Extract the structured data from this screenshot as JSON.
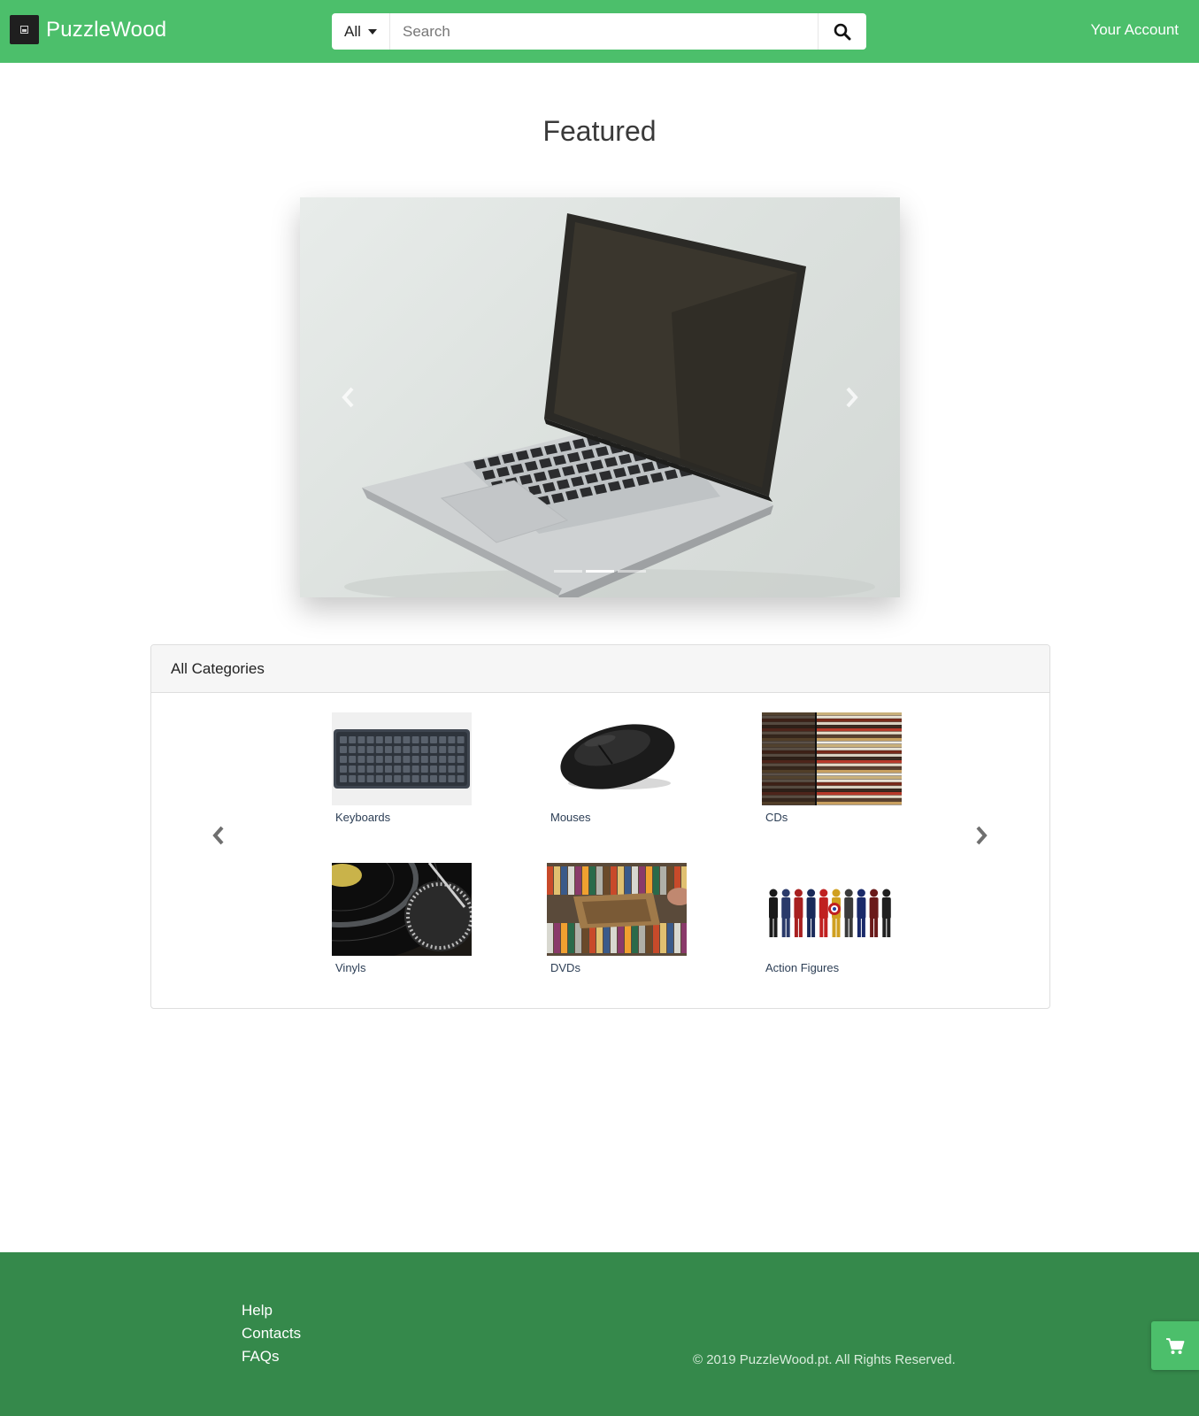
{
  "header": {
    "brand": "PuzzleWood",
    "search_scope": "All",
    "search_placeholder": "Search",
    "account_label": "Your Account"
  },
  "featured": {
    "title": "Featured",
    "slide_count": 3,
    "active_slide": 2
  },
  "categories": {
    "title": "All Categories",
    "items": [
      {
        "label": "Keyboards",
        "icon": "keyboard-thumbnail"
      },
      {
        "label": "Mouses",
        "icon": "mouse-thumbnail"
      },
      {
        "label": "CDs",
        "icon": "cds-thumbnail"
      },
      {
        "label": "Vinyls",
        "icon": "vinyl-thumbnail"
      },
      {
        "label": "DVDs",
        "icon": "dvds-thumbnail"
      },
      {
        "label": "Action Figures",
        "icon": "action-figures-thumbnail"
      }
    ]
  },
  "footer": {
    "links": [
      "Help",
      "Contacts",
      "FAQs"
    ],
    "copyright": "© 2019 PuzzleWood.pt. All Rights Reserved."
  },
  "colors": {
    "primary": "#4cbf6b",
    "footer": "#35894b"
  }
}
